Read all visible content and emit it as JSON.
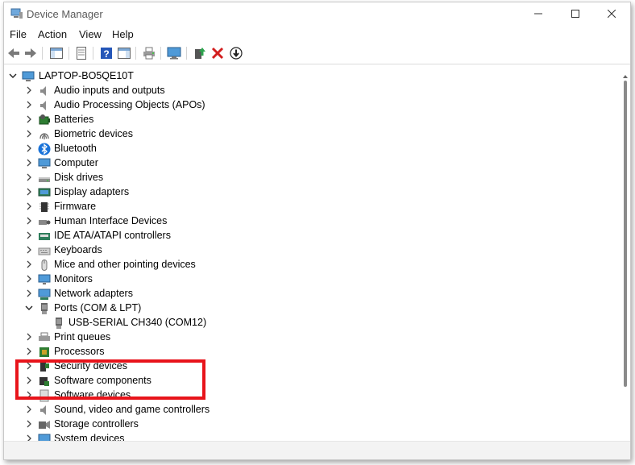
{
  "window": {
    "title": "Device Manager"
  },
  "menu": {
    "file": "File",
    "action": "Action",
    "view": "View",
    "help": "Help"
  },
  "toolbar": {
    "icons": [
      "back-icon",
      "forward-icon",
      "show-hide-console-tree-icon",
      "properties-icon",
      "help-icon",
      "action-pane-icon",
      "print-icon",
      "monitor-icon",
      "update-driver-icon",
      "uninstall-icon",
      "disable-icon"
    ]
  },
  "tree": {
    "root": "LAPTOP-BO5QE10T",
    "items": [
      {
        "label": "Audio inputs and outputs",
        "icon": "speaker-icon"
      },
      {
        "label": "Audio Processing Objects (APOs)",
        "icon": "speaker-icon"
      },
      {
        "label": "Batteries",
        "icon": "battery-icon"
      },
      {
        "label": "Biometric devices",
        "icon": "fingerprint-icon"
      },
      {
        "label": "Bluetooth",
        "icon": "bluetooth-icon"
      },
      {
        "label": "Computer",
        "icon": "computer-icon"
      },
      {
        "label": "Disk drives",
        "icon": "disk-icon"
      },
      {
        "label": "Display adapters",
        "icon": "display-adapter-icon"
      },
      {
        "label": "Firmware",
        "icon": "chip-icon"
      },
      {
        "label": "Human Interface Devices",
        "icon": "hid-icon"
      },
      {
        "label": "IDE ATA/ATAPI controllers",
        "icon": "ide-icon"
      },
      {
        "label": "Keyboards",
        "icon": "keyboard-icon"
      },
      {
        "label": "Mice and other pointing devices",
        "icon": "mouse-icon"
      },
      {
        "label": "Monitors",
        "icon": "monitor-icon"
      },
      {
        "label": "Network adapters",
        "icon": "network-icon"
      },
      {
        "label": "Ports (COM & LPT)",
        "icon": "port-icon",
        "expanded": true
      },
      {
        "label": "USB-SERIAL CH340 (COM12)",
        "icon": "port-icon",
        "child": true
      },
      {
        "label": "Print queues",
        "icon": "printer-icon"
      },
      {
        "label": "Processors",
        "icon": "processor-icon"
      },
      {
        "label": "Security devices",
        "icon": "security-icon"
      },
      {
        "label": "Software components",
        "icon": "software-component-icon"
      },
      {
        "label": "Software devices",
        "icon": "software-device-icon"
      },
      {
        "label": "Sound, video and game controllers",
        "icon": "sound-icon"
      },
      {
        "label": "Storage controllers",
        "icon": "storage-icon"
      },
      {
        "label": "System devices",
        "icon": "system-icon"
      }
    ]
  },
  "colors": {
    "highlight": "#e8141b",
    "accent": "#1a73d9"
  }
}
